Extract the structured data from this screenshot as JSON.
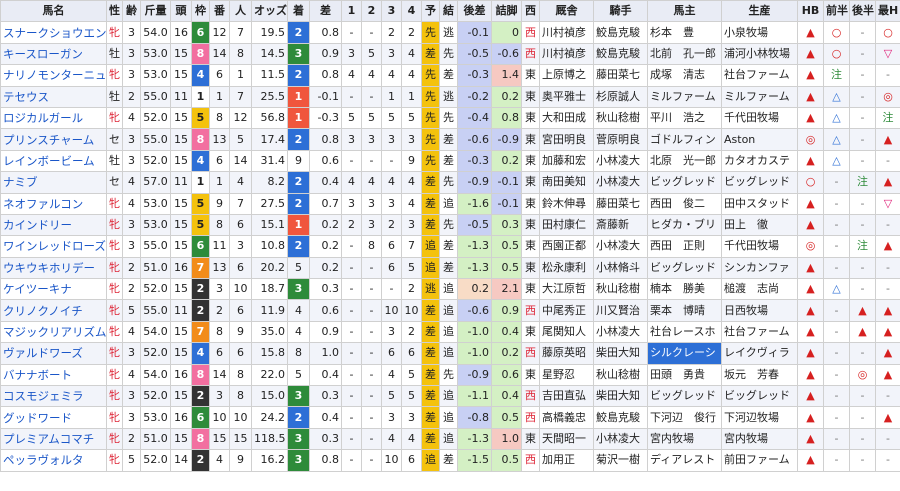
{
  "headers": [
    "馬名",
    "性",
    "齢",
    "斤量",
    "頭",
    "枠",
    "番",
    "人",
    "オッズ",
    "着",
    "差",
    "1",
    "2",
    "3",
    "4",
    "予",
    "結",
    "後差",
    "詰脚",
    "西",
    "厩舎",
    "騎手",
    "馬主",
    "生産",
    "HB",
    "前半",
    "後半",
    "最H"
  ],
  "rows": [
    {
      "name": "スナークショウエン",
      "sex": "牝",
      "age": "3",
      "kin": "54.0",
      "heads": "16",
      "waku": "6",
      "ban": "12",
      "nin": "7",
      "odds": "19.5",
      "chaku": "2",
      "sa": "0.8",
      "c1": "-",
      "c2": "-",
      "c3": "2",
      "c4": "2",
      "yo": "先",
      "ketsu": "逃",
      "gosa": "-0.1",
      "tsume": "0",
      "nishi": "西",
      "stable": "川村禎彦",
      "jockey": "鮫島克駿",
      "owner": "杉本　豊",
      "breeder": "小泉牧場",
      "hb": "▲",
      "zen": "○",
      "kou": "-",
      "saih": "○"
    },
    {
      "name": "キースローガン",
      "sex": "牡",
      "age": "3",
      "kin": "53.0",
      "heads": "15",
      "waku": "8",
      "ban": "14",
      "nin": "8",
      "odds": "14.5",
      "chaku": "3",
      "sa": "0.9",
      "c1": "3",
      "c2": "5",
      "c3": "3",
      "c4": "4",
      "yo": "差",
      "ketsu": "先",
      "gosa": "-0.5",
      "tsume": "-0.6",
      "nishi": "西",
      "stable": "川村禎彦",
      "jockey": "鮫島克駿",
      "owner": "北前　孔一郎",
      "breeder": "浦河小林牧場",
      "hb": "▲",
      "zen": "○",
      "kou": "-",
      "saih": "▽"
    },
    {
      "name": "ナリノモンターニュ",
      "sex": "牝",
      "age": "3",
      "kin": "53.0",
      "heads": "15",
      "waku": "4",
      "ban": "6",
      "nin": "1",
      "odds": "11.5",
      "chaku": "2",
      "sa": "0.8",
      "c1": "4",
      "c2": "4",
      "c3": "4",
      "c4": "4",
      "yo": "先",
      "ketsu": "差",
      "gosa": "-0.3",
      "tsume": "1.4",
      "nishi": "東",
      "stable": "上原博之",
      "jockey": "藤田菜七",
      "owner": "成塚　清志",
      "breeder": "社台ファーム",
      "hb": "▲",
      "zen": "注",
      "kou": "-",
      "saih": "-"
    },
    {
      "name": "テセウス",
      "sex": "牡",
      "age": "2",
      "kin": "55.0",
      "heads": "11",
      "waku": "1",
      "ban": "1",
      "nin": "7",
      "odds": "25.5",
      "chaku": "1",
      "sa": "-0.1",
      "c1": "-",
      "c2": "-",
      "c3": "1",
      "c4": "1",
      "yo": "先",
      "ketsu": "逃",
      "gosa": "-0.2",
      "tsume": "0.2",
      "nishi": "東",
      "stable": "奥平雅士",
      "jockey": "杉原誠人",
      "owner": "ミルファーム",
      "breeder": "ミルファーム",
      "hb": "▲",
      "zen": "△",
      "kou": "-",
      "saih": "◎"
    },
    {
      "name": "ロジカルガール",
      "sex": "牝",
      "age": "4",
      "kin": "52.0",
      "heads": "15",
      "waku": "5",
      "ban": "8",
      "nin": "12",
      "odds": "56.8",
      "chaku": "1",
      "sa": "-0.3",
      "c1": "5",
      "c2": "5",
      "c3": "5",
      "c4": "5",
      "yo": "先",
      "ketsu": "先",
      "gosa": "-0.4",
      "tsume": "0.8",
      "nishi": "東",
      "stable": "大和田成",
      "jockey": "秋山稔樹",
      "owner": "平川　浩之",
      "breeder": "千代田牧場",
      "hb": "▲",
      "zen": "△",
      "kou": "-",
      "saih": "注"
    },
    {
      "name": "プリンスチャーム",
      "sex": "セ",
      "age": "3",
      "kin": "55.0",
      "heads": "15",
      "waku": "8",
      "ban": "13",
      "nin": "5",
      "odds": "17.4",
      "chaku": "2",
      "sa": "0.8",
      "c1": "3",
      "c2": "3",
      "c3": "3",
      "c4": "3",
      "yo": "先",
      "ketsu": "差",
      "gosa": "-0.6",
      "tsume": "-0.9",
      "nishi": "東",
      "stable": "宮田明良",
      "jockey": "菅原明良",
      "owner": "ゴドルフィン",
      "breeder": "Aston",
      "hb": "◎",
      "zen": "△",
      "kou": "-",
      "saih": "▲"
    },
    {
      "name": "レインボービーム",
      "sex": "牡",
      "age": "3",
      "kin": "52.0",
      "heads": "15",
      "waku": "4",
      "ban": "6",
      "nin": "14",
      "odds": "31.4",
      "chaku": "9",
      "sa": "0.6",
      "c1": "-",
      "c2": "-",
      "c3": "-",
      "c4": "9",
      "yo": "先",
      "ketsu": "差",
      "gosa": "-0.3",
      "tsume": "0.2",
      "nishi": "東",
      "stable": "加藤和宏",
      "jockey": "小林凌大",
      "owner": "北原　光一郎",
      "breeder": "カタオカステ",
      "hb": "▲",
      "zen": "△",
      "kou": "-",
      "saih": "-"
    },
    {
      "name": "ナミブ",
      "sex": "セ",
      "age": "4",
      "kin": "57.0",
      "heads": "11",
      "waku": "1",
      "ban": "1",
      "nin": "4",
      "odds": "8.2",
      "chaku": "2",
      "sa": "0.4",
      "c1": "4",
      "c2": "4",
      "c3": "4",
      "c4": "4",
      "yo": "差",
      "ketsu": "先",
      "gosa": "-0.9",
      "tsume": "-0.1",
      "nishi": "東",
      "stable": "南田美知",
      "jockey": "小林凌大",
      "owner": "ビッグレッド",
      "breeder": "ビッグレッド",
      "hb": "○",
      "zen": "-",
      "kou": "注",
      "saih": "▲"
    },
    {
      "name": "ネオファルコン",
      "sex": "牝",
      "age": "4",
      "kin": "53.0",
      "heads": "15",
      "waku": "5",
      "ban": "9",
      "nin": "7",
      "odds": "27.5",
      "chaku": "2",
      "sa": "0.7",
      "c1": "3",
      "c2": "3",
      "c3": "3",
      "c4": "4",
      "yo": "差",
      "ketsu": "追",
      "gosa": "-1.6",
      "tsume": "-0.1",
      "nishi": "東",
      "stable": "鈴木伸尋",
      "jockey": "藤田菜七",
      "owner": "西田　俊二",
      "breeder": "田中スタッド",
      "hb": "▲",
      "zen": "-",
      "kou": "-",
      "saih": "▽"
    },
    {
      "name": "カインドリー",
      "sex": "牝",
      "age": "3",
      "kin": "53.0",
      "heads": "15",
      "waku": "5",
      "ban": "8",
      "nin": "6",
      "odds": "15.1",
      "chaku": "1",
      "sa": "0.2",
      "c1": "2",
      "c2": "3",
      "c3": "2",
      "c4": "3",
      "yo": "差",
      "ketsu": "先",
      "gosa": "-0.5",
      "tsume": "0.3",
      "nishi": "東",
      "stable": "田村康仁",
      "jockey": "斎藤新",
      "owner": "ヒダカ・ブリ",
      "breeder": "田上　徹",
      "hb": "▲",
      "zen": "-",
      "kou": "-",
      "saih": "-"
    },
    {
      "name": "ワインレッドローズ",
      "sex": "牝",
      "age": "3",
      "kin": "55.0",
      "heads": "15",
      "waku": "6",
      "ban": "11",
      "nin": "3",
      "odds": "10.8",
      "chaku": "2",
      "sa": "0.2",
      "c1": "-",
      "c2": "8",
      "c3": "6",
      "c4": "7",
      "yo": "追",
      "ketsu": "差",
      "gosa": "-1.3",
      "tsume": "0.5",
      "nishi": "東",
      "stable": "西園正都",
      "jockey": "小林凌大",
      "owner": "西田　正則",
      "breeder": "千代田牧場",
      "hb": "◎",
      "zen": "-",
      "kou": "注",
      "saih": "▲"
    },
    {
      "name": "ウキウキホリデー",
      "sex": "牝",
      "age": "2",
      "kin": "51.0",
      "heads": "16",
      "waku": "7",
      "ban": "13",
      "nin": "6",
      "odds": "20.2",
      "chaku": "5",
      "sa": "0.2",
      "c1": "-",
      "c2": "-",
      "c3": "6",
      "c4": "5",
      "yo": "追",
      "ketsu": "差",
      "gosa": "-1.3",
      "tsume": "0.5",
      "nishi": "東",
      "stable": "松永康利",
      "jockey": "小林脩斗",
      "owner": "ビッグレッド",
      "breeder": "シンカンファ",
      "hb": "▲",
      "zen": "-",
      "kou": "-",
      "saih": "-"
    },
    {
      "name": "ケイツーキナ",
      "sex": "牝",
      "age": "2",
      "kin": "52.0",
      "heads": "15",
      "waku": "2",
      "ban": "3",
      "nin": "10",
      "odds": "18.7",
      "chaku": "3",
      "sa": "0.3",
      "c1": "-",
      "c2": "-",
      "c3": "-",
      "c4": "2",
      "yo": "逃",
      "ketsu": "追",
      "gosa": "0.2",
      "tsume": "2.1",
      "nishi": "東",
      "stable": "大江原哲",
      "jockey": "秋山稔樹",
      "owner": "楠本　勝美",
      "breeder": "槌渡　志尚",
      "hb": "▲",
      "zen": "△",
      "kou": "-",
      "saih": "-"
    },
    {
      "name": "クリノクノイチ",
      "sex": "牝",
      "age": "5",
      "kin": "55.0",
      "heads": "11",
      "waku": "2",
      "ban": "2",
      "nin": "6",
      "odds": "11.9",
      "chaku": "4",
      "sa": "0.6",
      "c1": "-",
      "c2": "-",
      "c3": "10",
      "c4": "10",
      "yo": "差",
      "ketsu": "追",
      "gosa": "-0.6",
      "tsume": "0.9",
      "nishi": "西",
      "stable": "中尾秀正",
      "jockey": "川又賢治",
      "owner": "栗本　博晴",
      "breeder": "日西牧場",
      "hb": "▲",
      "zen": "-",
      "kou": "▲",
      "saih": "▲"
    },
    {
      "name": "マジックリアリズム",
      "sex": "牝",
      "age": "4",
      "kin": "54.0",
      "heads": "15",
      "waku": "7",
      "ban": "8",
      "nin": "9",
      "odds": "35.0",
      "chaku": "4",
      "sa": "0.9",
      "c1": "-",
      "c2": "-",
      "c3": "3",
      "c4": "2",
      "yo": "差",
      "ketsu": "追",
      "gosa": "-1.0",
      "tsume": "0.4",
      "nishi": "東",
      "stable": "尾関知人",
      "jockey": "小林凌大",
      "owner": "社台レースホ",
      "breeder": "社台ファーム",
      "hb": "▲",
      "zen": "-",
      "kou": "▲",
      "saih": "▲"
    },
    {
      "name": "ヴァルドワーズ",
      "sex": "牝",
      "age": "3",
      "kin": "52.0",
      "heads": "15",
      "waku": "4",
      "ban": "6",
      "nin": "6",
      "odds": "15.8",
      "chaku": "8",
      "sa": "1.0",
      "c1": "-",
      "c2": "-",
      "c3": "6",
      "c4": "6",
      "yo": "差",
      "ketsu": "追",
      "gosa": "-1.0",
      "tsume": "0.2",
      "nishi": "西",
      "stable": "藤原英昭",
      "jockey": "柴田大知",
      "owner": "シルクレーシ",
      "breeder": "レイクヴィラ",
      "hb": "▲",
      "zen": "-",
      "kou": "-",
      "saih": "▲"
    },
    {
      "name": "バナナボート",
      "sex": "牝",
      "age": "4",
      "kin": "54.0",
      "heads": "16",
      "waku": "8",
      "ban": "14",
      "nin": "8",
      "odds": "22.0",
      "chaku": "5",
      "sa": "0.4",
      "c1": "-",
      "c2": "-",
      "c3": "4",
      "c4": "5",
      "yo": "差",
      "ketsu": "先",
      "gosa": "-0.9",
      "tsume": "0.6",
      "nishi": "東",
      "stable": "星野忍",
      "jockey": "秋山稔樹",
      "owner": "田頭　勇貴",
      "breeder": "坂元　芳春",
      "hb": "▲",
      "zen": "-",
      "kou": "◎",
      "saih": "▲"
    },
    {
      "name": "コスモジェミラ",
      "sex": "牝",
      "age": "3",
      "kin": "52.0",
      "heads": "15",
      "waku": "2",
      "ban": "3",
      "nin": "8",
      "odds": "15.0",
      "chaku": "3",
      "sa": "0.3",
      "c1": "-",
      "c2": "-",
      "c3": "5",
      "c4": "5",
      "yo": "差",
      "ketsu": "追",
      "gosa": "-1.1",
      "tsume": "0.4",
      "nishi": "西",
      "stable": "吉田直弘",
      "jockey": "柴田大知",
      "owner": "ビッグレッド",
      "breeder": "ビッグレッド",
      "hb": "▲",
      "zen": "-",
      "kou": "-",
      "saih": "-"
    },
    {
      "name": "グッドワード",
      "sex": "牝",
      "age": "3",
      "kin": "53.0",
      "heads": "16",
      "waku": "6",
      "ban": "10",
      "nin": "10",
      "odds": "24.2",
      "chaku": "2",
      "sa": "0.4",
      "c1": "-",
      "c2": "-",
      "c3": "3",
      "c4": "3",
      "yo": "差",
      "ketsu": "追",
      "gosa": "-0.8",
      "tsume": "0.5",
      "nishi": "西",
      "stable": "高橋義忠",
      "jockey": "鮫島克駿",
      "owner": "下河辺　俊行",
      "breeder": "下河辺牧場",
      "hb": "▲",
      "zen": "-",
      "kou": "-",
      "saih": "▲"
    },
    {
      "name": "プレミアムコマチ",
      "sex": "牝",
      "age": "2",
      "kin": "51.0",
      "heads": "15",
      "waku": "8",
      "ban": "15",
      "nin": "15",
      "odds": "118.5",
      "chaku": "3",
      "sa": "0.3",
      "c1": "-",
      "c2": "-",
      "c3": "4",
      "c4": "4",
      "yo": "差",
      "ketsu": "追",
      "gosa": "-1.3",
      "tsume": "1.0",
      "nishi": "東",
      "stable": "天間昭一",
      "jockey": "小林凌大",
      "owner": "宮内牧場",
      "breeder": "宮内牧場",
      "hb": "▲",
      "zen": "-",
      "kou": "-",
      "saih": "-"
    },
    {
      "name": "ペッラヴォルタ",
      "sex": "牝",
      "age": "5",
      "kin": "52.0",
      "heads": "14",
      "waku": "2",
      "ban": "4",
      "nin": "9",
      "odds": "16.2",
      "chaku": "3",
      "sa": "0.8",
      "c1": "-",
      "c2": "-",
      "c3": "10",
      "c4": "6",
      "yo": "追",
      "ketsu": "差",
      "gosa": "-1.5",
      "tsume": "0.5",
      "nishi": "西",
      "stable": "加用正",
      "jockey": "菊沢一樹",
      "owner": "ディアレスト",
      "breeder": "前田ファーム",
      "hb": "▲",
      "zen": "-",
      "kou": "-",
      "saih": "-"
    }
  ],
  "colors": {
    "waku1": "#ffffff",
    "waku2": "#333333",
    "waku3": "#e0332e",
    "waku4": "#2d6fd6",
    "waku5": "#f4c20d",
    "waku6": "#2e8b3a",
    "waku7": "#f28c1a",
    "waku8": "#f26fa0",
    "accent_red": "#f0563d",
    "accent_blue": "#2d6fd6"
  }
}
